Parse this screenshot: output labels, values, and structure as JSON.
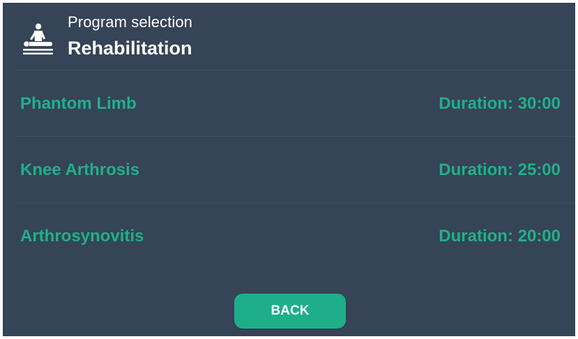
{
  "header": {
    "icon": "physiotherapy-massage-icon",
    "subtitle": "Program selection",
    "title": "Rehabilitation"
  },
  "programs": [
    {
      "name": "Phantom Limb",
      "duration": "Duration: 30:00"
    },
    {
      "name": "Knee Arthrosis",
      "duration": "Duration: 25:00"
    },
    {
      "name": "Arthrosynovitis",
      "duration": "Duration: 20:00"
    }
  ],
  "footer": {
    "back_label": "BACK"
  },
  "colors": {
    "background": "#354456",
    "accent": "#1fb08c",
    "text_primary": "#ffffff"
  }
}
